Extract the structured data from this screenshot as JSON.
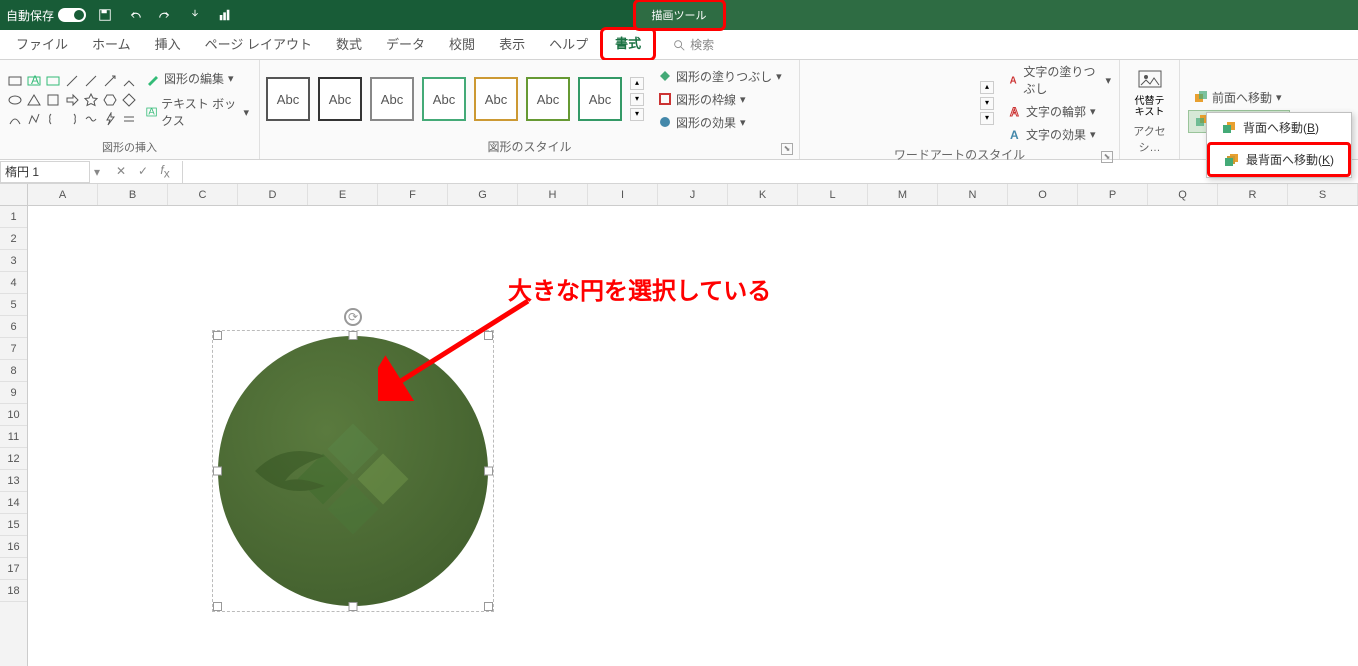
{
  "titlebar": {
    "autosave_label": "自動保存",
    "autosave_state": "オン",
    "tool_tab": "描画ツール"
  },
  "tabs": [
    "ファイル",
    "ホーム",
    "挿入",
    "ページ レイアウト",
    "数式",
    "データ",
    "校閲",
    "表示",
    "ヘルプ",
    "書式"
  ],
  "search_placeholder": "検索",
  "ribbon": {
    "shapes_group": "図形の挿入",
    "shapes_edit": "図形の編集",
    "shapes_textbox": "テキスト ボックス",
    "styles_group": "図形のスタイル",
    "abc_label": "Abc",
    "fill": "図形の塗りつぶし",
    "outline": "図形の枠線",
    "effects": "図形の効果",
    "wordart_group": "ワードアートのスタイル",
    "text_fill": "文字の塗りつぶし",
    "text_outline": "文字の輪郭",
    "text_effects": "文字の効果",
    "alt_text": "代替テ\nキスト",
    "accessibility_group": "アクセシ…",
    "bring_forward": "前面へ移動",
    "send_backward": "背面へ移動",
    "menu_send_backward": "背面へ移動",
    "menu_send_backward_key": "B",
    "menu_send_to_back": "最背面へ移動",
    "menu_send_to_back_key": "K"
  },
  "namebox": "楕円 1",
  "columns": [
    "A",
    "B",
    "C",
    "D",
    "E",
    "F",
    "G",
    "H",
    "I",
    "J",
    "K",
    "L",
    "M",
    "N",
    "O",
    "P",
    "Q",
    "R",
    "S"
  ],
  "rows": [
    "1",
    "2",
    "3",
    "4",
    "5",
    "6",
    "7",
    "8",
    "9",
    "10",
    "11",
    "12",
    "13",
    "14",
    "15",
    "16",
    "17",
    "18"
  ],
  "annotation": "大きな円を選択している",
  "wordart_letter": "A"
}
